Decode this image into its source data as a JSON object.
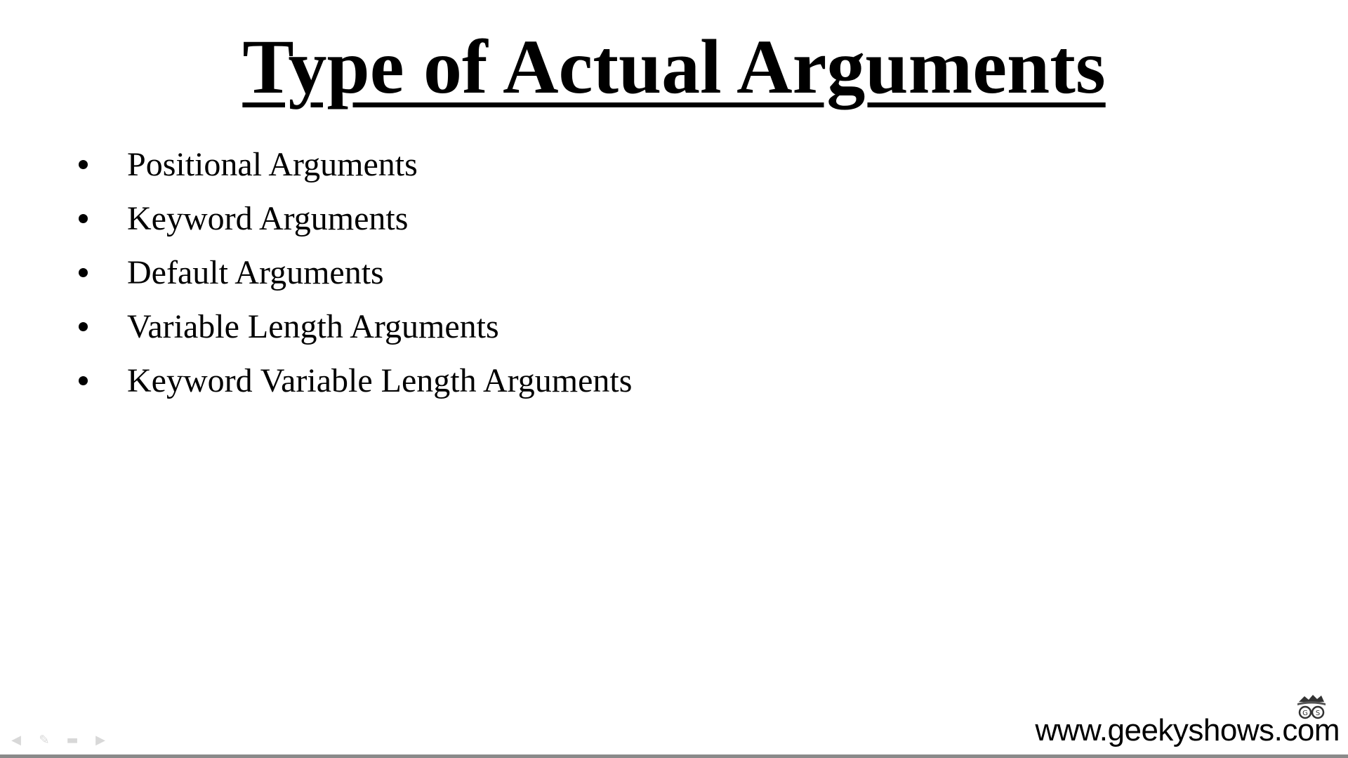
{
  "slide": {
    "title": "Type of Actual Arguments",
    "bullets": [
      "Positional Arguments",
      "Keyword Arguments",
      "Default Arguments",
      "Variable Length Arguments",
      "Keyword Variable Length Arguments"
    ],
    "footer_url": "www.geekyshows.com",
    "logo_icon": "geeky-shows-glasses-icon"
  },
  "nav": {
    "icons": [
      "arrow-left-icon",
      "pen-icon",
      "menu-icon",
      "arrow-right-icon"
    ]
  },
  "colors": {
    "background": "#ffffff",
    "text": "#000000",
    "bottom_bar": "#8a8a8a"
  }
}
